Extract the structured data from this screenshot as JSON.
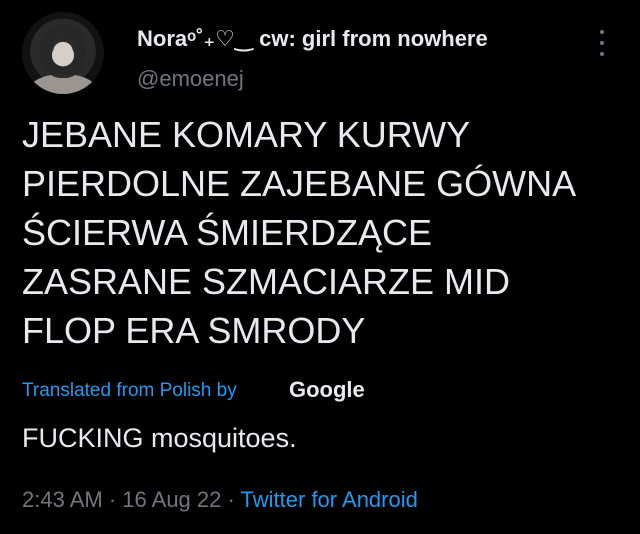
{
  "author": {
    "display_name": "Noraᵒ˚₊♡‿ cw: girl from nowhere",
    "handle": "@emoenej"
  },
  "tweet": {
    "lines": [
      "JEBANE KOMARY KURWY",
      "PIERDOLNE ZAJEBANE GÓWNA",
      "ŚCIERWA ŚMIERDZĄCE",
      "ZASRANE SZMACIARZE MID",
      "FLOP ERA SMRODY"
    ],
    "translated_label": "Translated from Polish by",
    "translator": "Google",
    "translation": "FUCKING mosquitoes."
  },
  "meta": {
    "time": "2:43 AM",
    "separator1": " · ",
    "date": "16 Aug 22",
    "separator2": " · ",
    "source": "Twitter for Android"
  },
  "icons": {
    "more": "more-options-icon",
    "avatar": "avatar"
  },
  "colors": {
    "background": "#000000",
    "text": "#e7e9ea",
    "secondary": "#71767b",
    "accent": "#1d9bf0"
  }
}
